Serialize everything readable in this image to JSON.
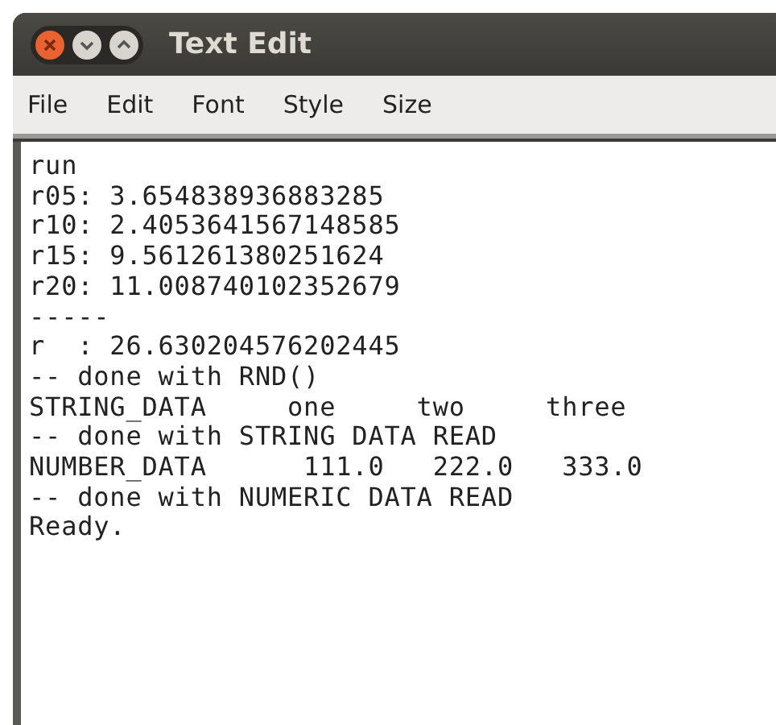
{
  "window": {
    "title": "Text Edit"
  },
  "menu": [
    "File",
    "Edit",
    "Font",
    "Style",
    "Size"
  ],
  "document": {
    "lines": [
      "run",
      "r05: 3.654838936883285",
      "r10: 2.4053641567148585",
      "r15: 9.561261380251624",
      "r20: 11.008740102352679",
      "-----",
      "r  : 26.630204576202445",
      "-- done with RND()",
      "STRING_DATA     one     two     three",
      "-- done with STRING DATA READ",
      "NUMBER_DATA      111.0   222.0   333.0",
      "-- done with NUMERIC DATA READ",
      "Ready."
    ]
  }
}
